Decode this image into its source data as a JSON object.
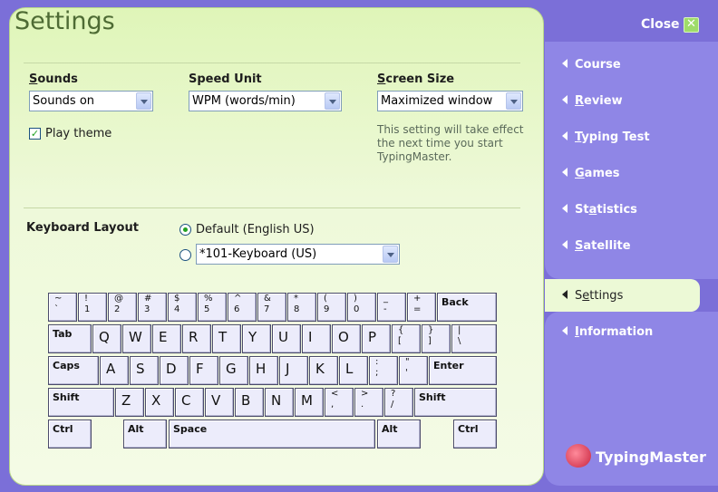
{
  "title": "Settings",
  "sounds": {
    "label_pre": "",
    "label_ul": "S",
    "label_post": "ounds",
    "value": "Sounds on",
    "play_theme": "Play theme"
  },
  "speed_unit": {
    "label": "Speed Unit",
    "value": "WPM (words/min)"
  },
  "screen_size": {
    "label_ul": "S",
    "label_post": "creen Size",
    "value": "Maximized window",
    "note": "This setting will take effect the next time you start TypingMaster."
  },
  "keyboard_layout": {
    "label": "Keyboard Layout",
    "option_default": "Default (English US)",
    "option_other": "*101-Keyboard (US)"
  },
  "keys": {
    "backquote_top": "~",
    "backquote_bot": "`",
    "d1_top": "!",
    "d1_bot": "1",
    "d2_top": "@",
    "d2_bot": "2",
    "d3_top": "#",
    "d3_bot": "3",
    "d4_top": "$",
    "d4_bot": "4",
    "d5_top": "%",
    "d5_bot": "5",
    "d6_top": "^",
    "d6_bot": "6",
    "d7_top": "&",
    "d7_bot": "7",
    "d8_top": "*",
    "d8_bot": "8",
    "d9_top": "(",
    "d9_bot": "9",
    "d0_top": ")",
    "d0_bot": "0",
    "minus_top": "_",
    "minus_bot": "-",
    "equal_top": "+",
    "equal_bot": "=",
    "back": "Back",
    "tab": "Tab",
    "q": "Q",
    "w": "W",
    "e": "E",
    "r": "R",
    "t": "T",
    "y": "Y",
    "u": "U",
    "i": "I",
    "o": "O",
    "p": "P",
    "lbracket_top": "{",
    "lbracket_bot": "[",
    "rbracket_top": "}",
    "rbracket_bot": "]",
    "backslash_top": "|",
    "backslash_bot": "\\",
    "caps": "Caps",
    "a": "A",
    "s": "S",
    "d": "D",
    "f": "F",
    "g": "G",
    "h": "H",
    "j": "J",
    "k": "K",
    "l": "L",
    "semicolon_top": ":",
    "semicolon_bot": ";",
    "quote_top": "\"",
    "quote_bot": "'",
    "enter": "Enter",
    "shift": "Shift",
    "z": "Z",
    "x": "X",
    "c": "C",
    "v": "V",
    "b": "B",
    "n": "N",
    "m": "M",
    "comma_top": "<",
    "comma_bot": ",",
    "period_top": ">",
    "period_bot": ".",
    "slash_top": "?",
    "slash_bot": "/",
    "ctrl": "Ctrl",
    "alt": "Alt",
    "space": "Space"
  },
  "sidebar": {
    "close": "Close",
    "items": [
      {
        "ul": "",
        "label": "Course"
      },
      {
        "ul": "R",
        "rest": "eview"
      },
      {
        "ul": "T",
        "rest": "yping Test"
      },
      {
        "ul": "G",
        "rest": "ames"
      },
      {
        "pre": "St",
        "ul": "a",
        "rest": "tistics"
      },
      {
        "ul": "S",
        "rest": "atellite"
      },
      {
        "pre": "S",
        "ul": "e",
        "rest": "ttings"
      },
      {
        "ul": "I",
        "rest": "nformation"
      }
    ]
  },
  "brand": "TypingMaster"
}
